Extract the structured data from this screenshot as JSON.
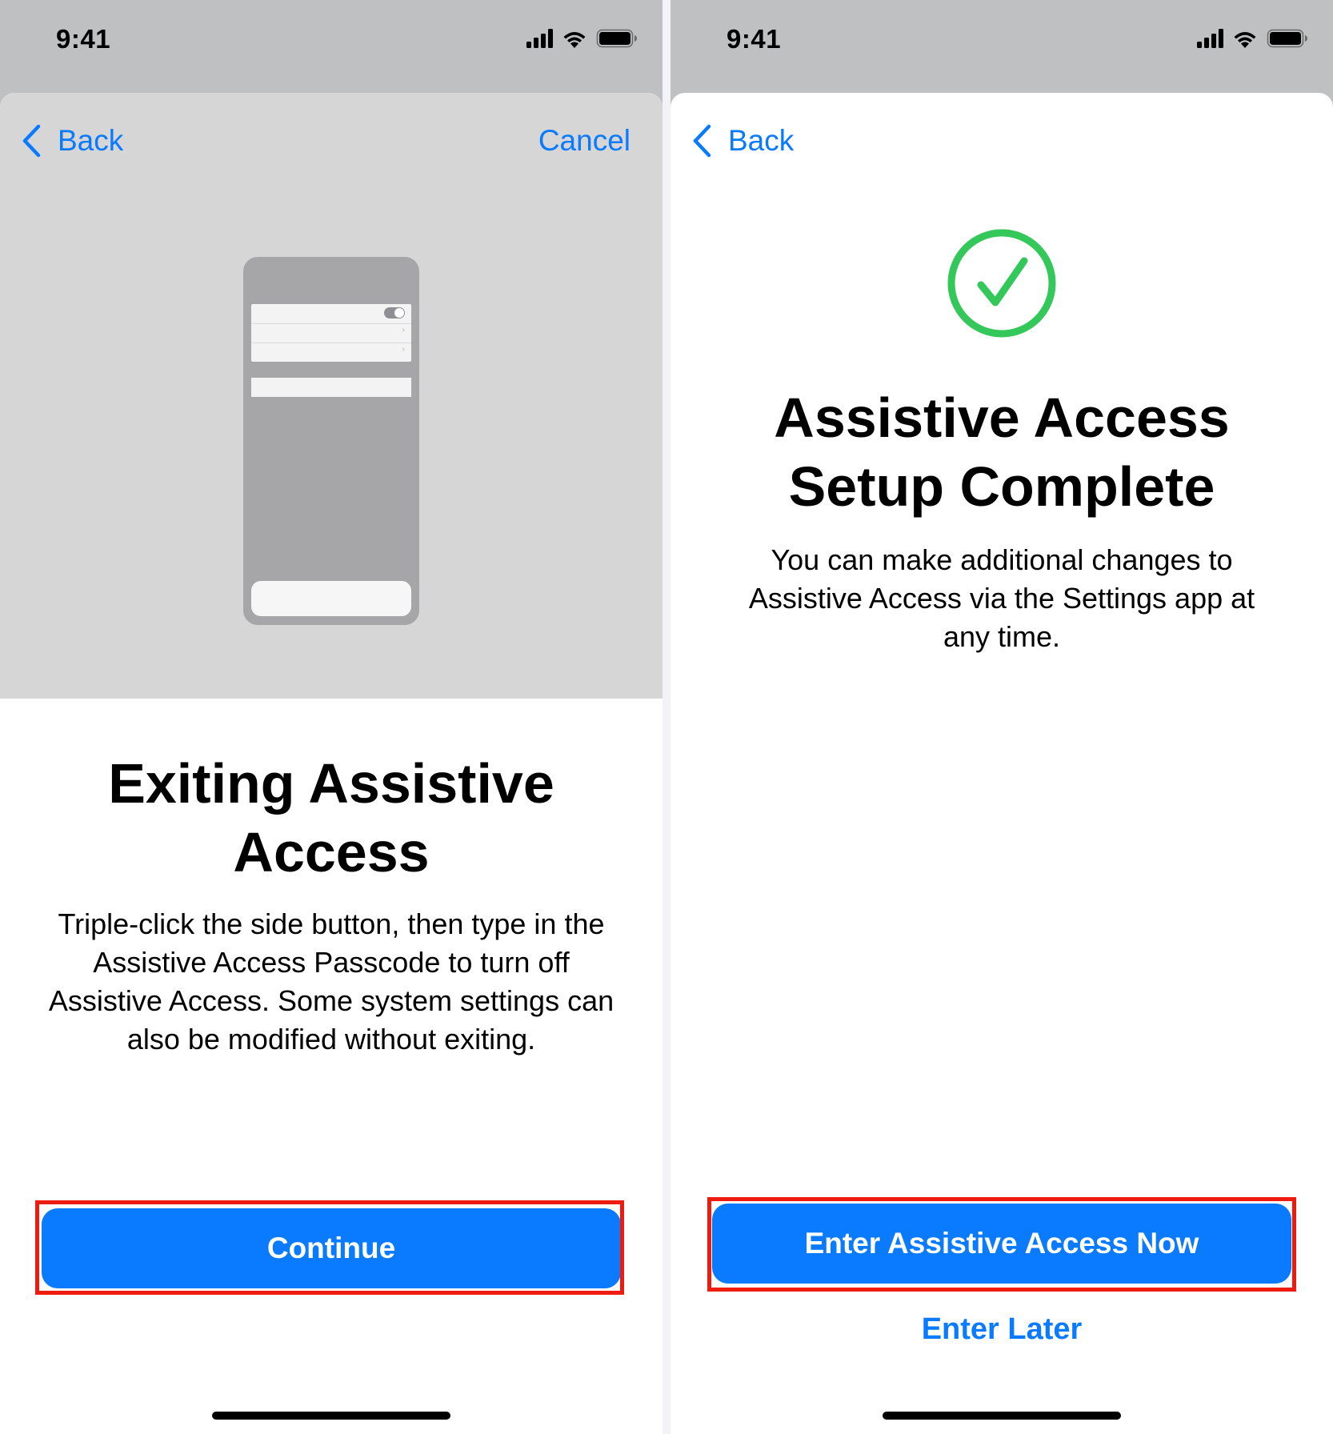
{
  "left_screen": {
    "status_time": "9:41",
    "nav": {
      "back_label": "Back",
      "cancel_label": "Cancel"
    },
    "title": "Exiting Assistive Access",
    "body": "Triple-click the side button, then type in the Assistive Access Passcode to turn off Assistive Access. Some system settings can also be modified without exiting.",
    "primary_button": "Continue"
  },
  "right_screen": {
    "status_time": "9:41",
    "nav": {
      "back_label": "Back"
    },
    "title": "Assistive Access Setup Complete",
    "body": "You can make additional changes to Assistive Access via the Settings app at any time.",
    "primary_button": "Enter Assistive Access Now",
    "secondary_button": "Enter Later"
  },
  "icons": [
    "chevron-left-icon",
    "cellular-signal-icon",
    "wifi-icon",
    "battery-icon",
    "checkmark-circle-icon"
  ],
  "colors": {
    "accent": "#0a7aff",
    "highlight": "#ee1c0e",
    "success": "#34c759",
    "hero_background": "#d6d6d6"
  }
}
